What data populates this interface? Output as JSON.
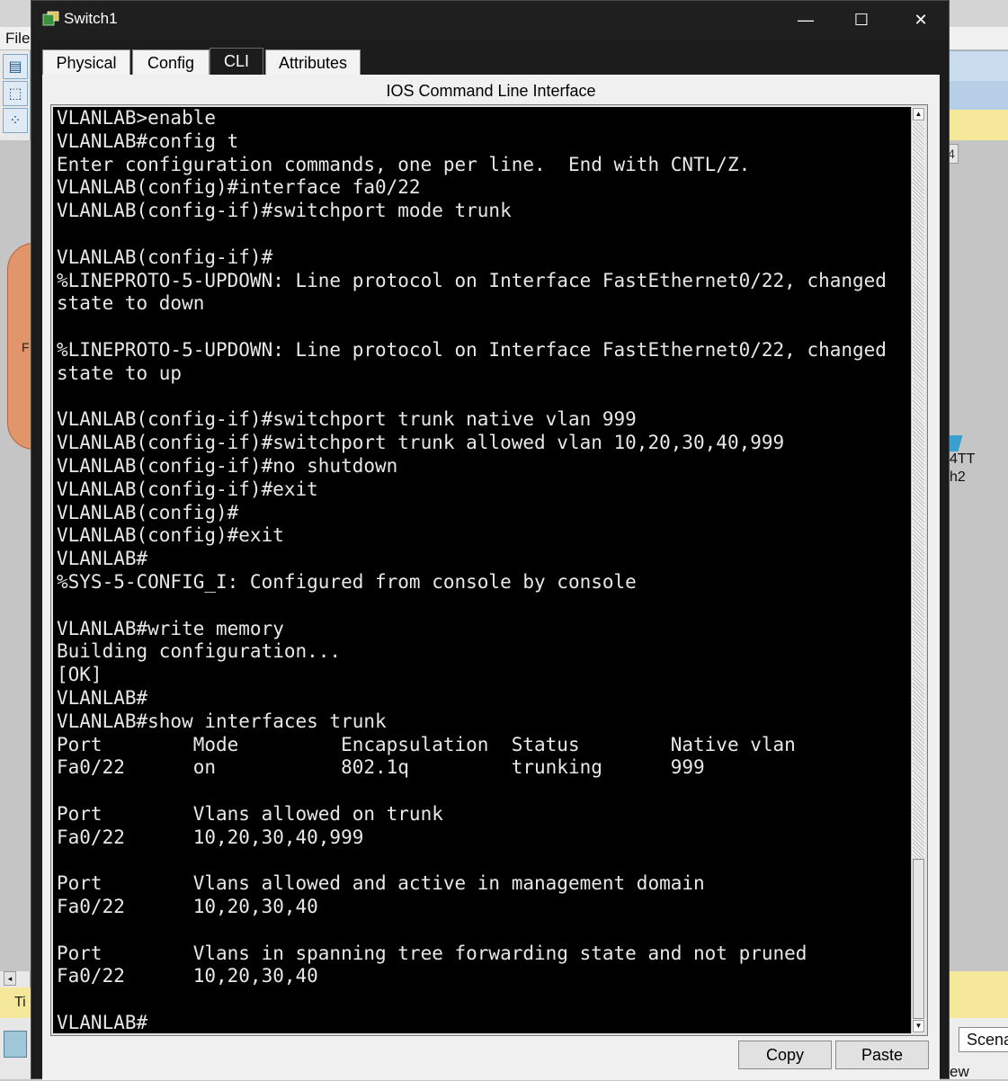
{
  "background_app": {
    "menu_file": "File",
    "left_label": "F",
    "scroll_left_arrow": "◂",
    "yellow_left_text": "Ti",
    "right_marker": "4",
    "right_device_line1": "4TT",
    "right_device_line2": "h2",
    "scenario_label": "Scena",
    "view_label": "ew"
  },
  "window": {
    "title": "Switch1",
    "minimize": "—",
    "maximize": "☐",
    "close": "✕"
  },
  "tabs": [
    {
      "label": "Physical"
    },
    {
      "label": "Config"
    },
    {
      "label": "CLI"
    },
    {
      "label": "Attributes"
    }
  ],
  "cli": {
    "heading": "IOS Command Line Interface",
    "lines": [
      "VLANLAB>enable",
      "VLANLAB#config t",
      "Enter configuration commands, one per line.  End with CNTL/Z.",
      "VLANLAB(config)#interface fa0/22",
      "VLANLAB(config-if)#switchport mode trunk",
      "",
      "VLANLAB(config-if)#",
      "%LINEPROTO-5-UPDOWN: Line protocol on Interface FastEthernet0/22, changed",
      "state to down",
      "",
      "%LINEPROTO-5-UPDOWN: Line protocol on Interface FastEthernet0/22, changed",
      "state to up",
      "",
      "VLANLAB(config-if)#switchport trunk native vlan 999",
      "VLANLAB(config-if)#switchport trunk allowed vlan 10,20,30,40,999",
      "VLANLAB(config-if)#no shutdown",
      "VLANLAB(config-if)#exit",
      "VLANLAB(config)#",
      "VLANLAB(config)#exit",
      "VLANLAB#",
      "%SYS-5-CONFIG_I: Configured from console by console",
      "",
      "VLANLAB#write memory",
      "Building configuration...",
      "[OK]",
      "VLANLAB#",
      "VLANLAB#show interfaces trunk",
      "Port        Mode         Encapsulation  Status        Native vlan",
      "Fa0/22      on           802.1q         trunking      999",
      "",
      "Port        Vlans allowed on trunk",
      "Fa0/22      10,20,30,40,999",
      "",
      "Port        Vlans allowed and active in management domain",
      "Fa0/22      10,20,30,40",
      "",
      "Port        Vlans in spanning tree forwarding state and not pruned",
      "Fa0/22      10,20,30,40",
      "",
      "VLANLAB#"
    ],
    "scroll_up": "▲",
    "scroll_down": "▼"
  },
  "buttons": {
    "copy": "Copy",
    "paste": "Paste"
  }
}
